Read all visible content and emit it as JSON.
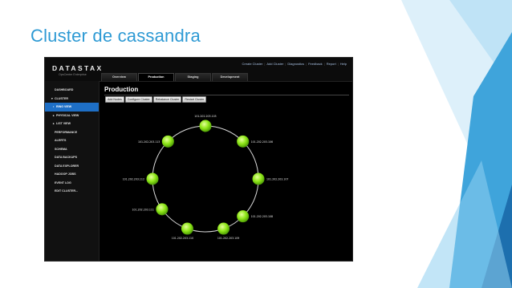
{
  "slide": {
    "title": "Cluster de cassandra"
  },
  "colors": {
    "accent": "#2e9ad4",
    "node": "#8fe619",
    "nav_active": "#1e6fc6"
  },
  "app": {
    "logo": "DATASTAX",
    "logo_sub": "OpsCenter Enterprise",
    "top_links": [
      "Create Cluster",
      "Add Cluster",
      "Diagnostics",
      "Feedback",
      "Report",
      "Help"
    ],
    "tabs": [
      "Overview",
      "Production",
      "Staging",
      "Development"
    ],
    "active_tab": "Production",
    "sidebar": [
      {
        "label": "DASHBOARD",
        "level": 0,
        "bullet": ""
      },
      {
        "label": "CLUSTER",
        "level": 0,
        "bullet": "▾"
      },
      {
        "label": "RING VIEW",
        "level": 1,
        "bullet": "•",
        "active": true
      },
      {
        "label": "PHYSICAL VIEW",
        "level": 1,
        "bullet": "▸"
      },
      {
        "label": "LIST VIEW",
        "level": 1,
        "bullet": "▸"
      },
      {
        "label": "PERFORMANCE",
        "level": 0,
        "bullet": ""
      },
      {
        "label": "ALERTS",
        "level": 0,
        "bullet": ""
      },
      {
        "label": "SCHEMA",
        "level": 0,
        "bullet": ""
      },
      {
        "label": "DATA BACKUPS",
        "level": 0,
        "bullet": ""
      },
      {
        "label": "DATA EXPLORER",
        "level": 0,
        "bullet": ""
      },
      {
        "label": "HADOOP JOBS",
        "level": 0,
        "bullet": ""
      },
      {
        "label": "EVENT LOG",
        "level": 0,
        "bullet": ""
      },
      {
        "label": "EDIT CLUSTER...",
        "level": 0,
        "bullet": ""
      }
    ],
    "main_title": "Production",
    "actions": [
      "Add Nodes",
      "Configure Cluster",
      "Rebalance Cluster",
      "Restart Cluster"
    ],
    "ring": {
      "nodes": [
        {
          "label": "101.202.203.105",
          "angle": 0
        },
        {
          "label": "101.202.203.106",
          "angle": 45
        },
        {
          "label": "101.202.203.107",
          "angle": 90
        },
        {
          "label": "101.202.203.108",
          "angle": 135
        },
        {
          "label": "101.202.203.109",
          "angle": 160
        },
        {
          "label": "101.202.203.110",
          "angle": 200
        },
        {
          "label": "101.202.203.111",
          "angle": 235
        },
        {
          "label": "101.202.203.112",
          "angle": 270
        },
        {
          "label": "101.202.203.113",
          "angle": 315
        }
      ]
    }
  }
}
